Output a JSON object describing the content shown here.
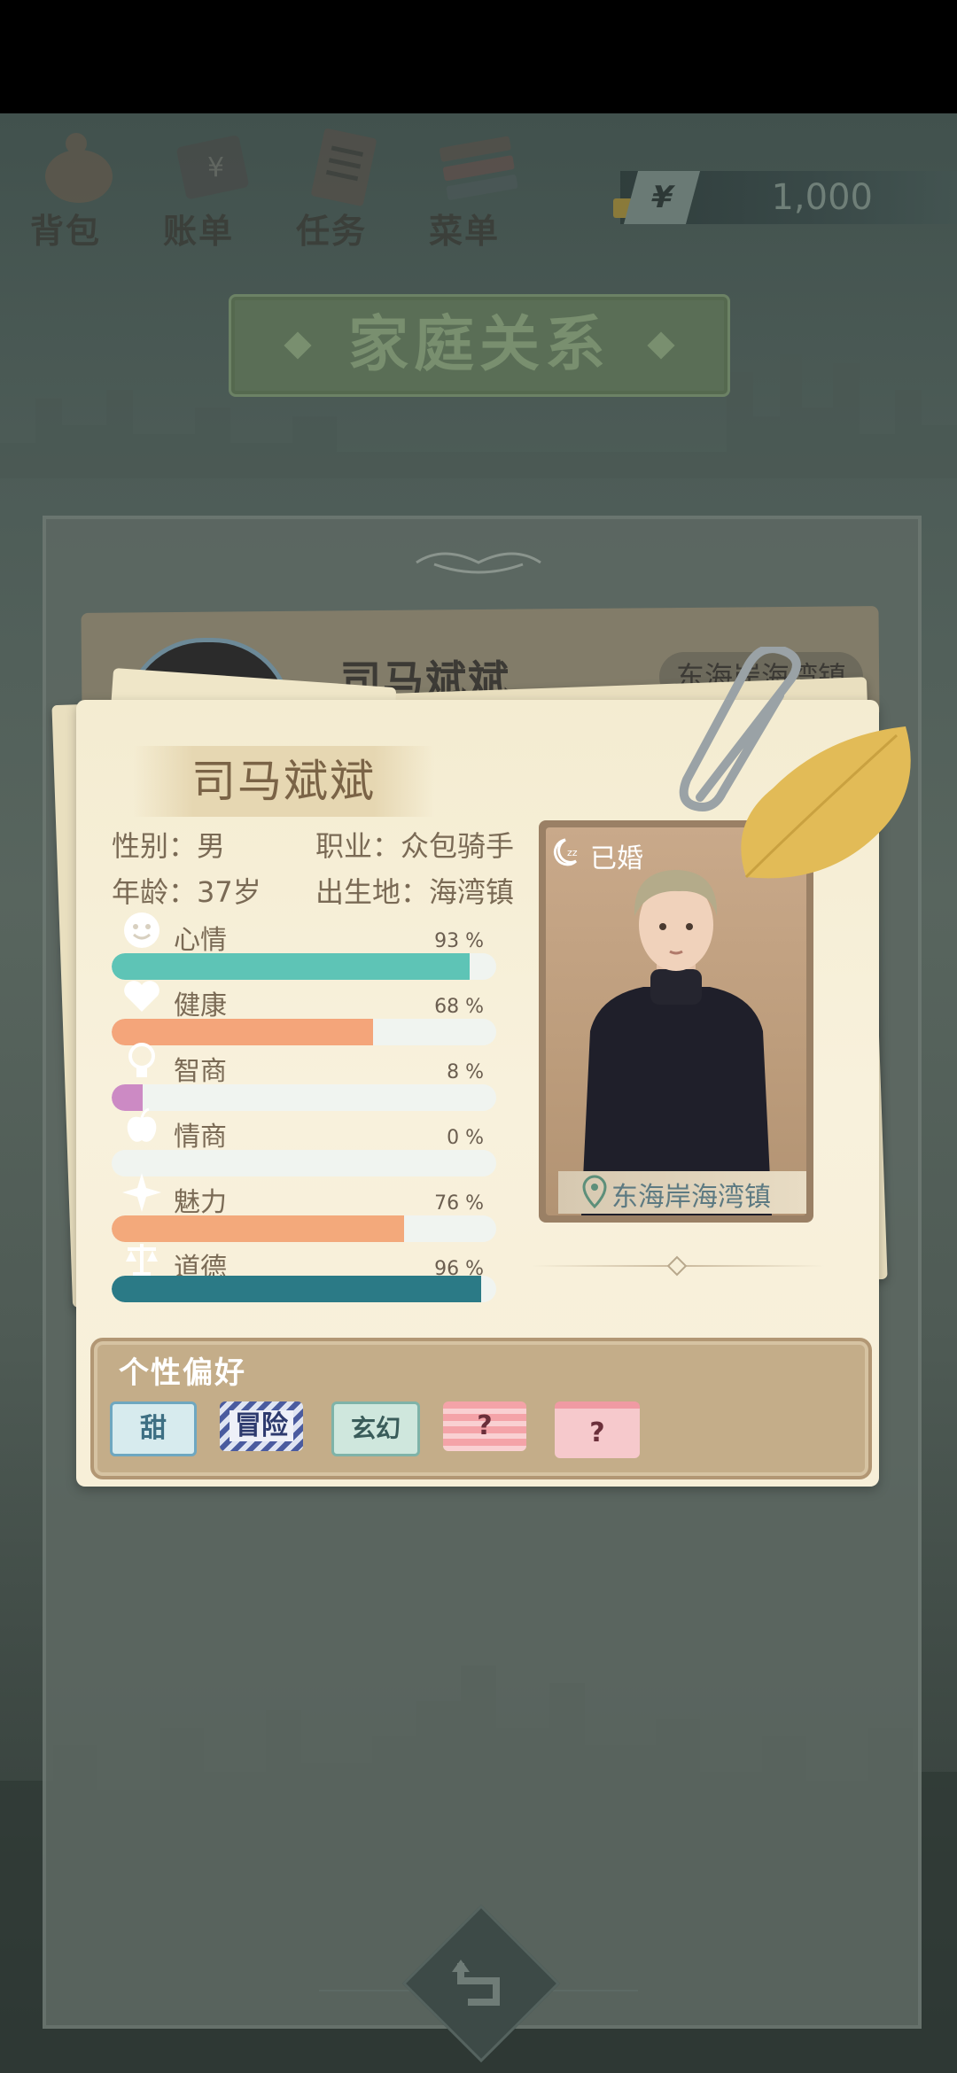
{
  "menu": {
    "items": [
      {
        "label": "背包",
        "icon": "bag-icon"
      },
      {
        "label": "账单",
        "icon": "bill-icon"
      },
      {
        "label": "任务",
        "icon": "task-icon"
      },
      {
        "label": "菜单",
        "icon": "menu-icon"
      }
    ]
  },
  "currency": {
    "symbol": "¥",
    "amount": "1,000"
  },
  "page_title": "家庭关系",
  "back_card": {
    "name": "司马斌斌",
    "location": "东海岸海湾镇"
  },
  "character": {
    "name": "司马斌斌",
    "gender_label": "性别：",
    "gender": "男",
    "job_label": "职业：",
    "job": "众包骑手",
    "age_label": "年龄：",
    "age": "37岁",
    "birthplace_label": "出生地：",
    "birthplace": "海湾镇",
    "marital_status": "已婚",
    "location": "东海岸海湾镇"
  },
  "stats": [
    {
      "label": "心情",
      "percent_text": "93 %",
      "value": 0.93,
      "color": "#5ec4b6",
      "icon": "smile-icon"
    },
    {
      "label": "健康",
      "percent_text": "68 %",
      "value": 0.68,
      "color": "#f4a57a",
      "icon": "heart-icon"
    },
    {
      "label": "智商",
      "percent_text": "8 %",
      "value": 0.08,
      "color": "#cc8ac4",
      "icon": "bulb-icon"
    },
    {
      "label": "情商",
      "percent_text": "0 %",
      "value": 0.0,
      "color": "#9ec5d8",
      "icon": "apple-icon"
    },
    {
      "label": "魅力",
      "percent_text": "76 %",
      "value": 0.76,
      "color": "#f3a97b",
      "icon": "sparkle-icon"
    },
    {
      "label": "道德",
      "percent_text": "96 %",
      "value": 0.96,
      "color": "#2b7a86",
      "icon": "scale-icon"
    }
  ],
  "preferences": {
    "title": "个性偏好",
    "tags": [
      "甜",
      "冒险",
      "玄幻",
      "?",
      "?"
    ]
  }
}
